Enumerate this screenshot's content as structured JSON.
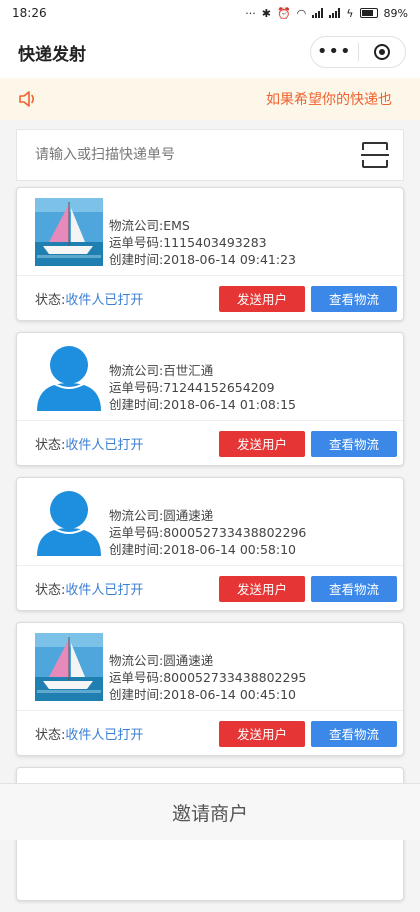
{
  "status_bar": {
    "time": "18:26",
    "indicators": "···",
    "battery": "89%"
  },
  "nav": {
    "title": "快递发射",
    "more_icon": "•••"
  },
  "notice": {
    "text": "如果希望你的快递也"
  },
  "search": {
    "placeholder": "请输入或扫描快递单号",
    "value": ""
  },
  "cards": [
    {
      "avatar": "sailboat-photo",
      "company_label": "物流公司:",
      "company": "EMS",
      "waybill_label": "运单号码:",
      "waybill": "1115403493283",
      "created_label": "创建时间:",
      "created": "2018-06-14 09:41:23",
      "status_label": "状态:",
      "status": "收件人已打开",
      "send_label": "发送用户",
      "track_label": "查看物流"
    },
    {
      "avatar": "default-user",
      "company_label": "物流公司:",
      "company": "百世汇通",
      "waybill_label": "运单号码:",
      "waybill": "71244152654209",
      "created_label": "创建时间:",
      "created": "2018-06-14 01:08:15",
      "status_label": "状态:",
      "status": "收件人已打开",
      "send_label": "发送用户",
      "track_label": "查看物流"
    },
    {
      "avatar": "default-user",
      "company_label": "物流公司:",
      "company": "圆通速递",
      "waybill_label": "运单号码:",
      "waybill": "800052733438802296",
      "created_label": "创建时间:",
      "created": "2018-06-14 00:58:10",
      "status_label": "状态:",
      "status": "收件人已打开",
      "send_label": "发送用户",
      "track_label": "查看物流"
    },
    {
      "avatar": "sailboat-photo",
      "company_label": "物流公司:",
      "company": "圆通速递",
      "waybill_label": "运单号码:",
      "waybill": "800052733438802295",
      "created_label": "创建时间:",
      "created": "2018-06-14 00:45:10",
      "status_label": "状态:",
      "status": "收件人已打开",
      "send_label": "发送用户",
      "track_label": "查看物流"
    }
  ],
  "bottom": {
    "label": "邀请商户"
  },
  "colors": {
    "accent_red": "#e63535",
    "accent_blue": "#3b88e8",
    "status_blue": "#3a7fd5",
    "notice_orange": "#f0622f",
    "notice_bg": "#fcf7e8"
  }
}
